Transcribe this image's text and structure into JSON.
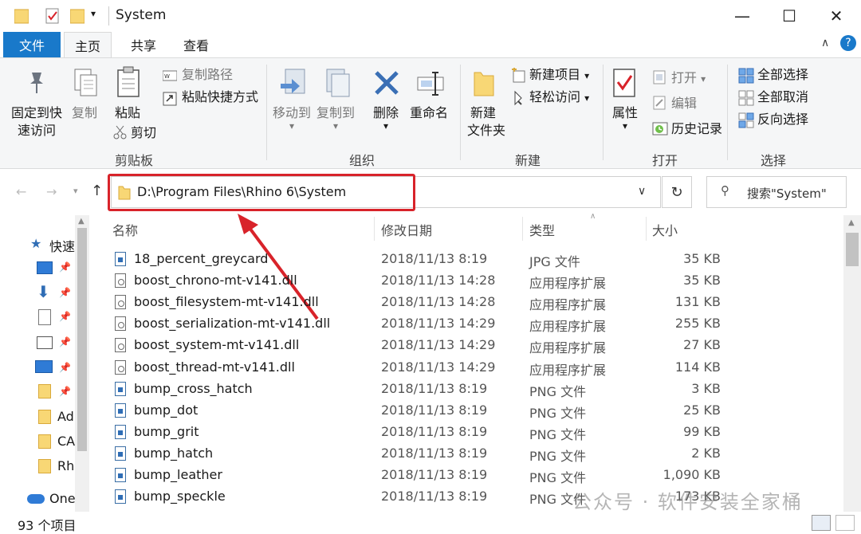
{
  "window": {
    "title": "System",
    "minimize": "—",
    "maximize": "☐",
    "close": "✕"
  },
  "tabs": {
    "file": "文件",
    "home": "主页",
    "share": "共享",
    "view": "查看"
  },
  "ribbon": {
    "clipboard": {
      "pin_quick_access": "固定到快\n速访问",
      "pin_line1": "固定到快",
      "pin_line2": "速访问",
      "copy": "复制",
      "paste": "粘贴",
      "copy_path": "复制路径",
      "paste_shortcut": "粘贴快捷方式",
      "cut": "剪切",
      "group_label": "剪贴板"
    },
    "organize": {
      "move_to": "移动到",
      "copy_to": "复制到",
      "delete": "删除",
      "rename": "重命名",
      "group_label": "组织"
    },
    "new": {
      "new_folder_line1": "新建",
      "new_folder_line2": "文件夹",
      "new_item": "新建项目",
      "easy_access": "轻松访问",
      "group_label": "新建"
    },
    "open": {
      "properties": "属性",
      "open": "打开",
      "edit": "编辑",
      "history": "历史记录",
      "group_label": "打开"
    },
    "select": {
      "select_all": "全部选择",
      "select_none": "全部取消",
      "invert_selection": "反向选择",
      "group_label": "选择"
    }
  },
  "address": {
    "path": "D:\\Program Files\\Rhino 6\\System",
    "search_placeholder": "搜索\"System\""
  },
  "nav": {
    "quick_access": "快速",
    "items": [
      "Ad",
      "CA",
      "Rh"
    ],
    "onedrive": "One"
  },
  "columns": {
    "name": "名称",
    "date": "修改日期",
    "type": "类型",
    "size": "大小"
  },
  "files": [
    {
      "name": "18_percent_greycard",
      "date": "2018/11/13 8:19",
      "type": "JPG 文件",
      "size": "35 KB",
      "kind": "img"
    },
    {
      "name": "boost_chrono-mt-v141.dll",
      "date": "2018/11/13 14:28",
      "type": "应用程序扩展",
      "size": "35 KB",
      "kind": "dll"
    },
    {
      "name": "boost_filesystem-mt-v141.dll",
      "date": "2018/11/13 14:28",
      "type": "应用程序扩展",
      "size": "131 KB",
      "kind": "dll"
    },
    {
      "name": "boost_serialization-mt-v141.dll",
      "date": "2018/11/13 14:29",
      "type": "应用程序扩展",
      "size": "255 KB",
      "kind": "dll"
    },
    {
      "name": "boost_system-mt-v141.dll",
      "date": "2018/11/13 14:29",
      "type": "应用程序扩展",
      "size": "27 KB",
      "kind": "dll"
    },
    {
      "name": "boost_thread-mt-v141.dll",
      "date": "2018/11/13 14:29",
      "type": "应用程序扩展",
      "size": "114 KB",
      "kind": "dll"
    },
    {
      "name": "bump_cross_hatch",
      "date": "2018/11/13 8:19",
      "type": "PNG 文件",
      "size": "3 KB",
      "kind": "img"
    },
    {
      "name": "bump_dot",
      "date": "2018/11/13 8:19",
      "type": "PNG 文件",
      "size": "25 KB",
      "kind": "img"
    },
    {
      "name": "bump_grit",
      "date": "2018/11/13 8:19",
      "type": "PNG 文件",
      "size": "99 KB",
      "kind": "img"
    },
    {
      "name": "bump_hatch",
      "date": "2018/11/13 8:19",
      "type": "PNG 文件",
      "size": "2 KB",
      "kind": "img"
    },
    {
      "name": "bump_leather",
      "date": "2018/11/13 8:19",
      "type": "PNG 文件",
      "size": "1,090 KB",
      "kind": "img"
    },
    {
      "name": "bump_speckle",
      "date": "2018/11/13 8:19",
      "type": "PNG 文件",
      "size": "173 KB",
      "kind": "img"
    }
  ],
  "status": {
    "item_count": "93 个项目"
  },
  "watermark": "公众号 · 软件安装全家桶",
  "colors": {
    "accent": "#1979ca",
    "highlight_box": "#d8232a",
    "folder": "#f8d775"
  }
}
